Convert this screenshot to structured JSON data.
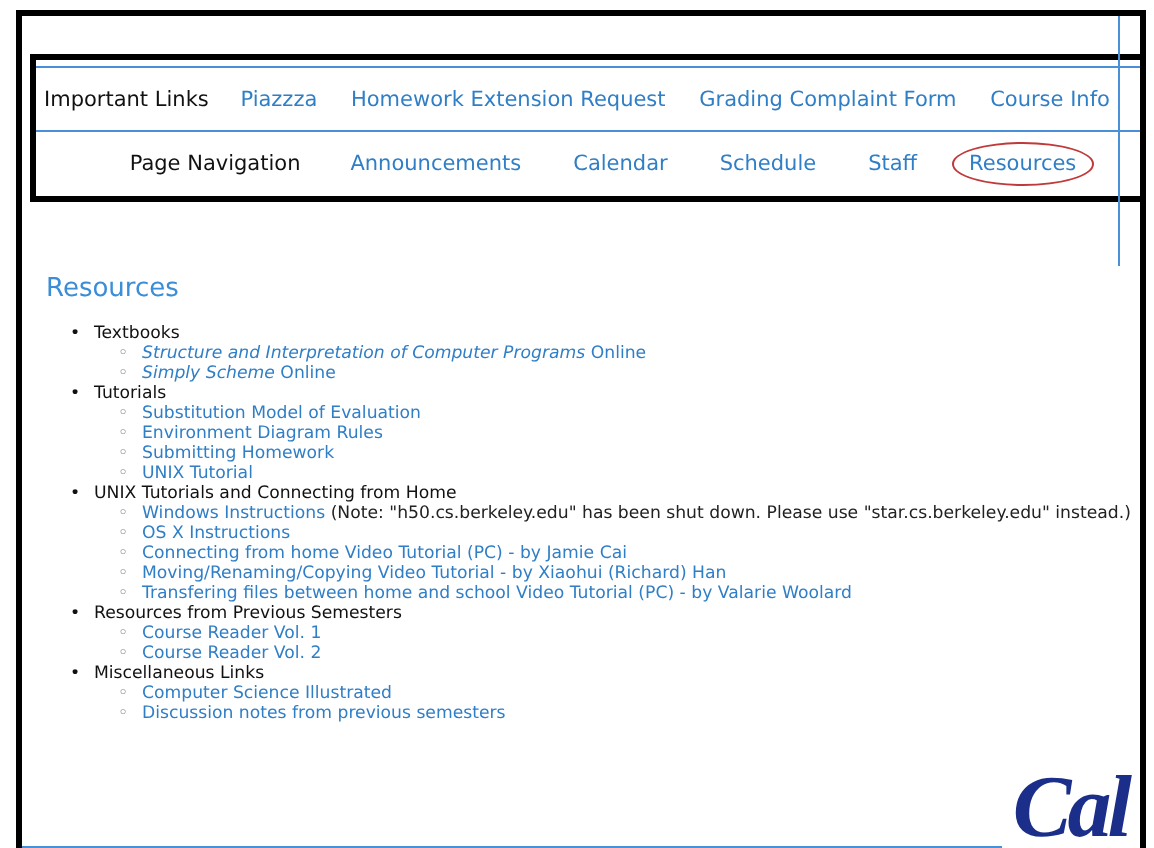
{
  "important_links": {
    "label": "Important Links",
    "links": [
      {
        "text": "Piazzza"
      },
      {
        "text": "Homework Extension Request"
      },
      {
        "text": "Grading Complaint Form"
      },
      {
        "text": "Course Info"
      }
    ]
  },
  "page_navigation": {
    "label": "Page Navigation",
    "links": [
      {
        "text": "Announcements",
        "circled": false
      },
      {
        "text": "Calendar",
        "circled": false
      },
      {
        "text": "Schedule",
        "circled": false
      },
      {
        "text": "Staff",
        "circled": false
      },
      {
        "text": "Resources",
        "circled": true
      }
    ]
  },
  "heading": "Resources",
  "sections": [
    {
      "marker": "•",
      "title": "Textbooks",
      "items": [
        {
          "marker": "◦",
          "text": "*Structure and Interpretation of Computer Programs* Online"
        },
        {
          "marker": "◦",
          "text": "*Simply Scheme* Online"
        }
      ]
    },
    {
      "marker": "•",
      "title": "Tutorials",
      "items": [
        {
          "marker": "◦",
          "text": "Substitution Model of Evaluation"
        },
        {
          "marker": "◦",
          "text": "Environment Diagram Rules"
        },
        {
          "marker": "◦",
          "text": "Submitting Homework"
        },
        {
          "marker": "◦",
          "text": "UNIX Tutorial"
        }
      ]
    },
    {
      "marker": "•",
      "title": "UNIX Tutorials and Connecting from Home",
      "items": [
        {
          "marker": "◦",
          "text": "Windows Instructions",
          "note": "(Note: \"h50.cs.berkeley.edu\" has been shut down. Please use \"star.cs.berkeley.edu\" instead.)"
        },
        {
          "marker": "◦",
          "text": "OS X Instructions"
        },
        {
          "marker": "◦",
          "text": "Connecting from home Video Tutorial (PC) - by Jamie Cai"
        },
        {
          "marker": "◦",
          "text": "Moving/Renaming/Copying Video Tutorial - by Xiaohui (Richard) Han"
        },
        {
          "marker": "◦",
          "text": "Transfering files between home and school Video Tutorial (PC) - by Valarie Woolard"
        }
      ]
    },
    {
      "marker": "•",
      "title": "Resources from Previous Semesters",
      "items": [
        {
          "marker": "◦",
          "text": "Course Reader Vol. 1"
        },
        {
          "marker": "◦",
          "text": "Course Reader Vol. 2"
        }
      ]
    },
    {
      "marker": "•",
      "title": "Miscellaneous Links",
      "items": [
        {
          "marker": "◦",
          "text": "Computer Science Illustrated"
        },
        {
          "marker": "◦",
          "text": "Discussion notes from previous semesters"
        }
      ]
    }
  ],
  "logo": "Cal"
}
